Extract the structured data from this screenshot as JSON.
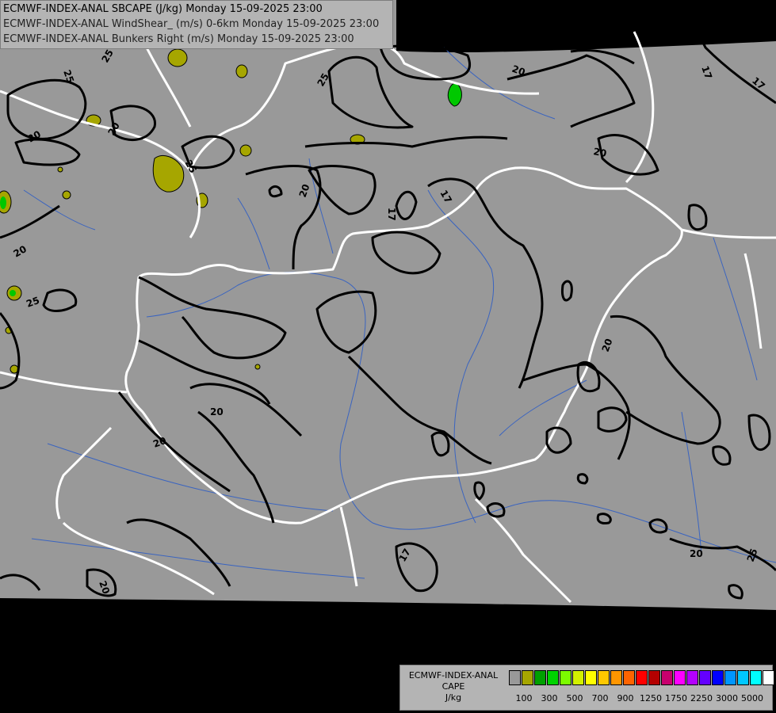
{
  "header": {
    "line1": "ECMWF-INDEX-ANAL SBCAPE (J/kg) Monday 15-09-2025 23:00",
    "line2": "ECMWF-INDEX-ANAL WindShear_ (m/s) 0-6km Monday 15-09-2025 23:00",
    "line3": "ECMWF-INDEX-ANAL Bunkers Right (m/s) Monday 15-09-2025 23:00"
  },
  "legend": {
    "title_line1": "ECMWF-INDEX-ANAL",
    "title_line2": "CAPE",
    "title_line3": "J/kg",
    "colors": [
      "#999999",
      "#a6a600",
      "#00a000",
      "#00d200",
      "#7cfc00",
      "#d2f000",
      "#ffff00",
      "#ffc800",
      "#ff9600",
      "#ff6400",
      "#ff0000",
      "#b40000",
      "#c8006e",
      "#ff00ff",
      "#b400ff",
      "#6400ff",
      "#0000ff",
      "#0096ff",
      "#00c8ff",
      "#00ffff",
      "#ffffff"
    ],
    "tick_labels": [
      "100",
      "300",
      "500",
      "700",
      "900",
      "1250",
      "1750",
      "2250",
      "3000",
      "5000"
    ]
  },
  "contour_labels": {
    "c25": "25",
    "c20": "20",
    "c17": "17"
  },
  "map": {
    "land_color": "#999999",
    "outside_color": "#000000",
    "contour_color": "#000000",
    "border_color": "#ffffff",
    "river_color": "#3264c8",
    "cape_color": "#a6a600"
  }
}
